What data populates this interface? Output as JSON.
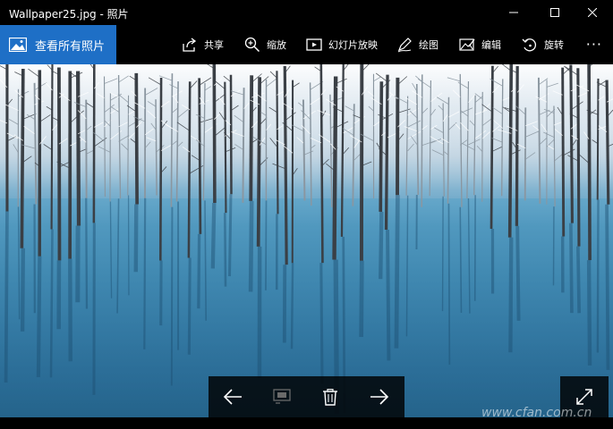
{
  "window": {
    "title": "Wallpaper25.jpg - 照片",
    "minimize_icon": "minimize-icon",
    "maximize_icon": "maximize-icon",
    "close_icon": "close-icon"
  },
  "toolbar": {
    "back_label": "查看所有照片",
    "share_label": "共享",
    "zoom_label": "缩放",
    "slideshow_label": "幻灯片放映",
    "draw_label": "绘图",
    "edit_label": "编辑",
    "rotate_label": "旋转",
    "more_label": "···"
  },
  "image": {
    "description": "snow-covered-trees-in-blue-pond"
  },
  "nav": {
    "prev_icon": "arrow-left-icon",
    "sendto_icon": "send-to-device-icon",
    "delete_icon": "trash-icon",
    "next_icon": "arrow-right-icon"
  },
  "fullscreen_icon": "expand-icon",
  "watermark": "www.cfan.com.cn",
  "colors": {
    "accent": "#1e6fc6",
    "toolbar_bg": "#000000",
    "water": "#3a86b2"
  }
}
